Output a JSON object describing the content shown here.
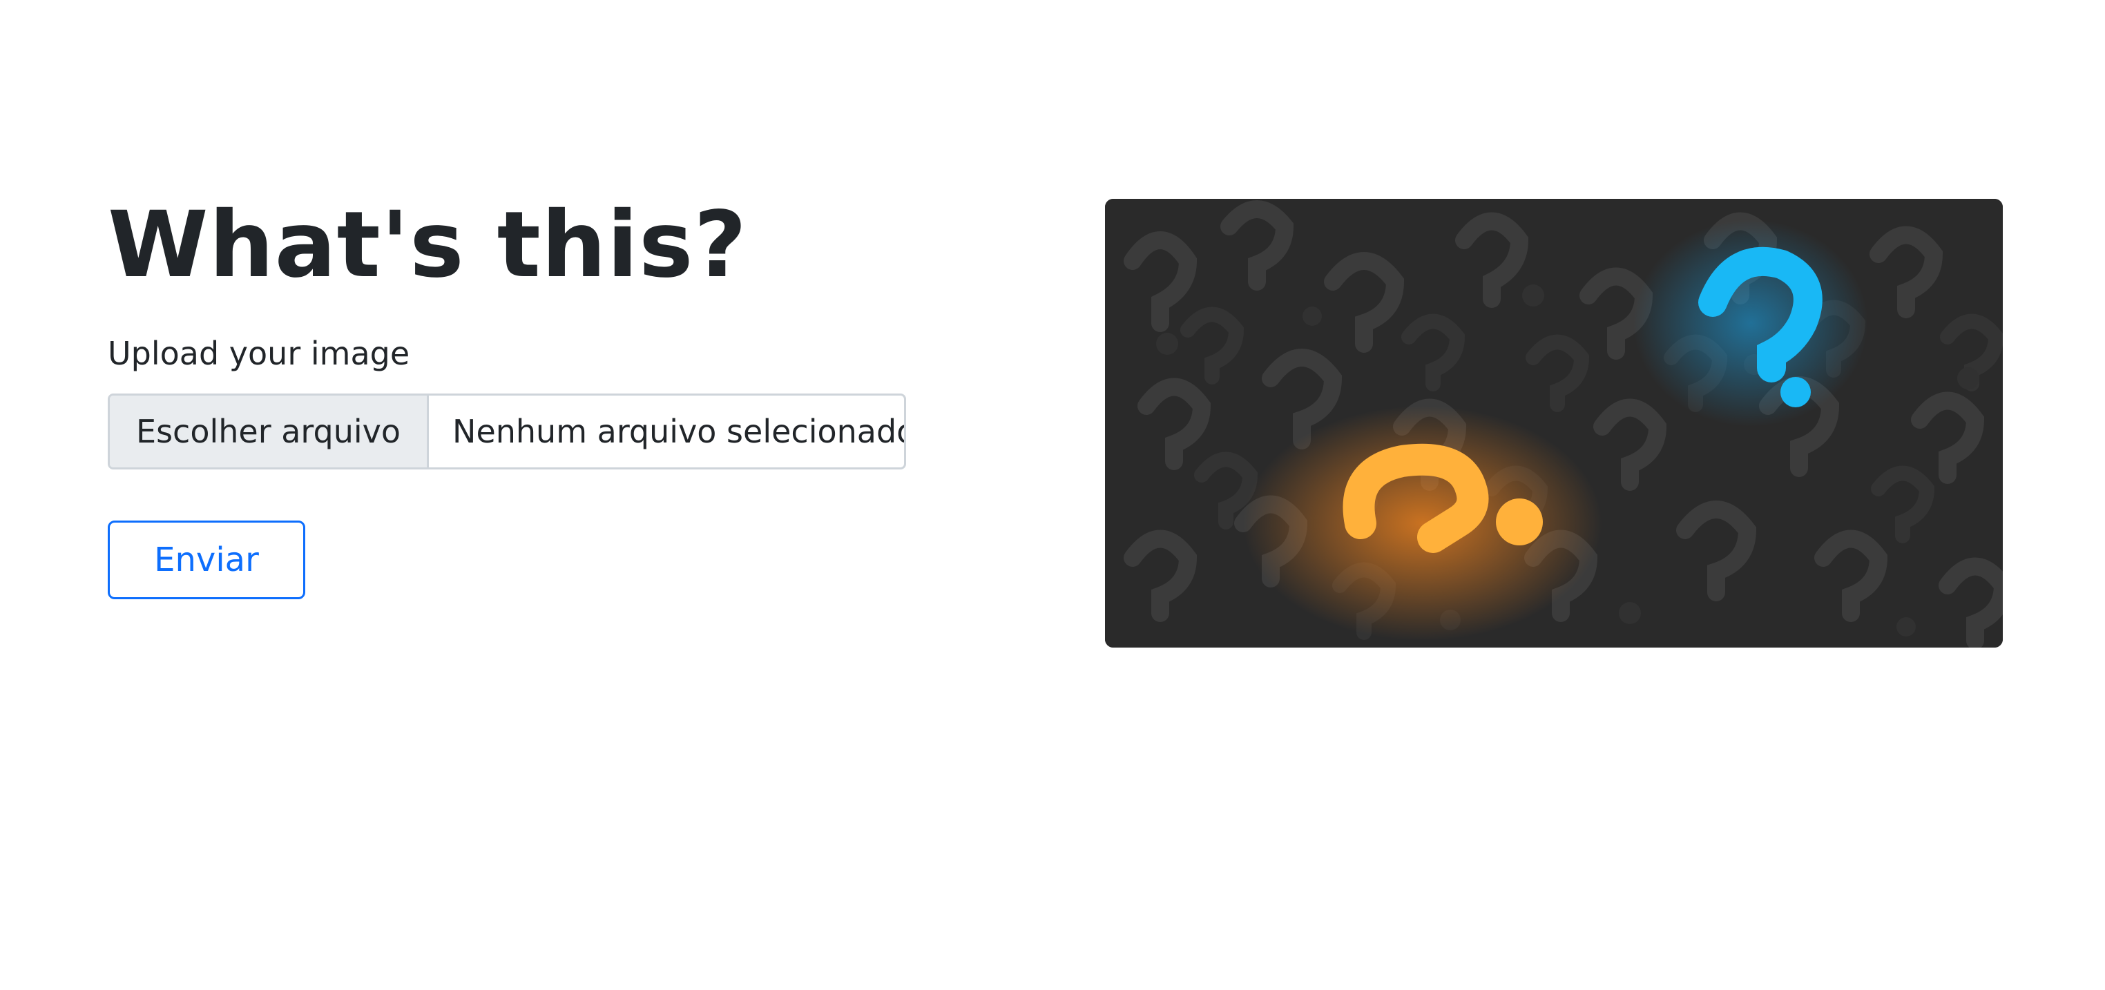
{
  "heading": {
    "title": "What's this?"
  },
  "upload": {
    "label": "Upload your image",
    "choose_file_label": "Escolher arquivo",
    "file_status": "Nenhum arquivo selecionado"
  },
  "submit": {
    "label": "Enviar"
  },
  "colors": {
    "primary": "#0d6efd",
    "text": "#212529",
    "border": "#ced4da",
    "file_button_bg": "#e9ecef",
    "image_bg": "#2a2a2a",
    "highlight_orange": "#ffb13b",
    "highlight_blue": "#19b8f5"
  },
  "image": {
    "subject": "question-marks-illustration"
  }
}
